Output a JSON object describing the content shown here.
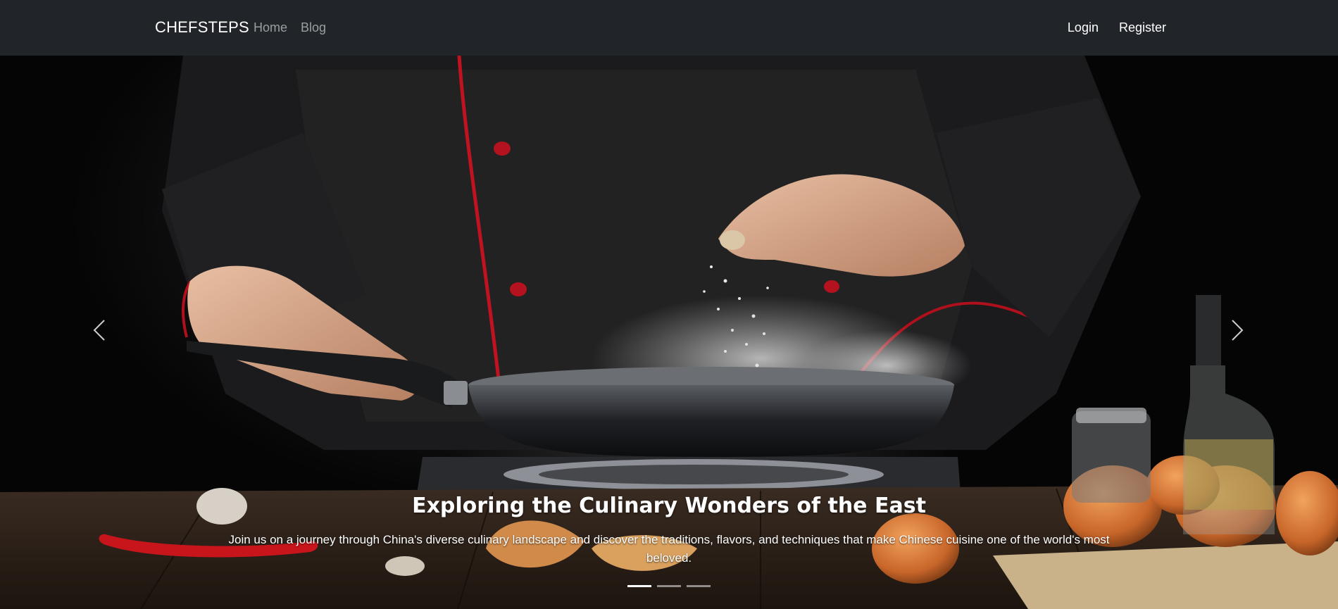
{
  "navbar": {
    "brand": "CHEFSTEPS",
    "left_links": [
      "Home",
      "Blog"
    ],
    "right_links": [
      "Login",
      "Register"
    ]
  },
  "hero": {
    "title": "Exploring the Culinary Wonders of the East",
    "description": "Join us on a journey through China's diverse culinary landscape and discover the traditions, flavors, and techniques that make Chinese cuisine one of the world's most beloved.",
    "slides_total": 3,
    "active_slide_index": 0
  },
  "icons": {
    "prev": "chevron-left-icon",
    "next": "chevron-right-icon"
  },
  "colors": {
    "navbar_bg": "#212529",
    "brand_text": "#ffffff",
    "muted_link": "rgba(255,255,255,0.55)",
    "chef_piping": "#c1121f"
  }
}
